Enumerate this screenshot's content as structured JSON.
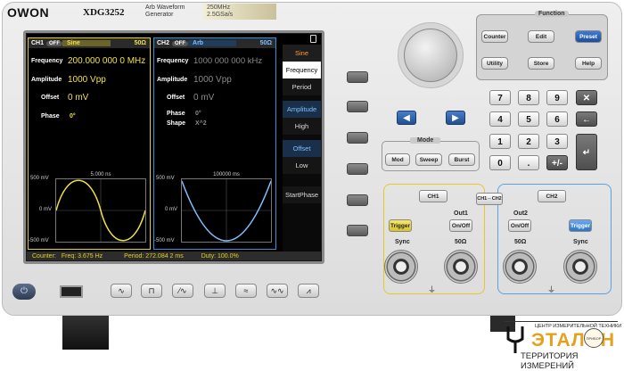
{
  "header": {
    "brand": "OWON",
    "model": "XDG3252",
    "description_line1": "Arb Waveform",
    "description_line2": "Generator",
    "spec_line1": "250MHz",
    "spec_line2": "2.5GSa/s"
  },
  "screen": {
    "ch1": {
      "name": "CH1",
      "state": "OFF",
      "wave": "Sine",
      "impedance": "50Ω",
      "frequency_label": "Frequency",
      "frequency_value": "200.000 000 0 MHz",
      "amplitude_label": "Amplitude",
      "amplitude_value": "1000 Vpp",
      "offset_label": "Offset",
      "offset_value": "0 mV",
      "phase_label": "Phase",
      "phase_value": "0°",
      "plot": {
        "time_label": "5.000 ns",
        "y_top": "500 mV",
        "y_mid": "0 mV",
        "y_bot": "-500 mV"
      }
    },
    "ch2": {
      "name": "CH2",
      "state": "OFF",
      "wave": "Arb",
      "impedance": "50Ω",
      "frequency_label": "Frequency",
      "frequency_value": "1000 000 000 kHz",
      "amplitude_label": "Amplitude",
      "amplitude_value": "1000 Vpp",
      "offset_label": "Offset",
      "offset_value": "0 mV",
      "phase_label": "Phase",
      "phase_value": "0°",
      "shape_label": "Shape",
      "shape_value": "X^2",
      "plot": {
        "time_label": "100000 ms",
        "y_top": "500 mV",
        "y_mid": "0 mV",
        "y_bot": "-500 mV"
      }
    },
    "menu": {
      "title": "Sine",
      "items": [
        "Frequency",
        "Period",
        "Amplitude",
        "High",
        "Offset",
        "Low",
        "StartPhase"
      ]
    },
    "status": {
      "counter": "Counter:",
      "freq": "Freq: 3.675 Hz",
      "period": "Period: 272.084 2 ms",
      "duty": "Duty: 100.0%"
    }
  },
  "function": {
    "title": "Function",
    "keys": [
      "Counter",
      "Edit",
      "Preset",
      "Utility",
      "Store",
      "Help"
    ]
  },
  "keypad": {
    "row1": [
      "7",
      "8",
      "9",
      "✕"
    ],
    "row2": [
      "4",
      "5",
      "6",
      "←"
    ],
    "row3": [
      "1",
      "2",
      "3"
    ],
    "row4": [
      "0",
      ".",
      "+/-"
    ],
    "enter": "↵"
  },
  "mode": {
    "title": "Mode",
    "keys": [
      "Mod",
      "Sweep",
      "Burst"
    ]
  },
  "channels": {
    "ch1_button": "CH1",
    "ch2_button": "CH2",
    "copy_button": "CH1⇔CH2",
    "out1_label": "Out1",
    "out2_label": "Out2",
    "onoff": "On/Off",
    "trigger": "Trigger",
    "sync": "Sync",
    "ohm": "50Ω"
  },
  "bottom": {
    "power": "⏻",
    "wave_keys": [
      "∿",
      "⊓",
      "⁄∿",
      "⊥",
      "≈",
      "∿∿",
      "⩘"
    ]
  },
  "watermark": {
    "top": "ЦЕНТР ИЗМЕРИТЕЛЬНОЙ ТЕХНИКИ",
    "main": "ЭТАЛОН",
    "sub": "ТЕРРИТОРИЯ ИЗМЕРЕНИЙ",
    "badge": "ПРИБОР"
  }
}
